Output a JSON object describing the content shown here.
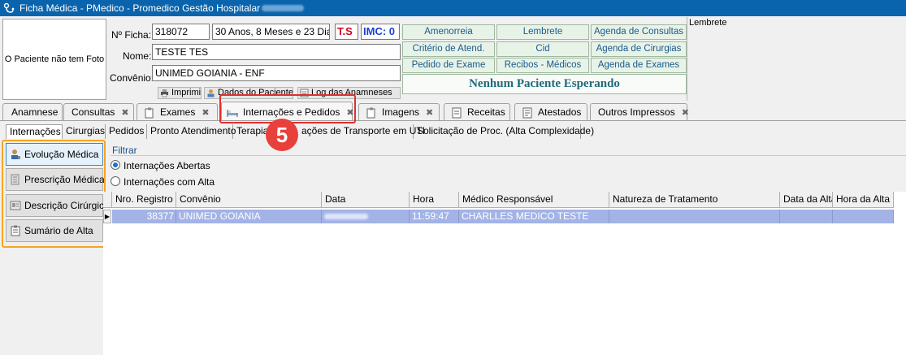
{
  "window": {
    "title": "Ficha Médica - PMedico - Promedico Gestão Hospitalar"
  },
  "patient": {
    "photo_text": "O Paciente não tem Foto",
    "ficha_label": "Nº Ficha:",
    "ficha_value": "318072",
    "age": "30 Anos, 8 Meses e 23 Dias",
    "ts": "T.S",
    "imc": "IMC: 0",
    "nome_label": "Nome:",
    "nome_value": "TESTE TES",
    "convenio_label": "Convênio:",
    "convenio_value": "UNIMED GOIANIA - ENF",
    "imprimir": "Imprimir",
    "dados": "Dados do Paciente",
    "log": "Log das Anamneses"
  },
  "shortcuts": {
    "r1": [
      "Amenorreia",
      "Lembrete",
      "Agenda de Consultas"
    ],
    "r2": [
      "Critério de Atend.",
      "Cid",
      "Agenda de Cirurgias"
    ],
    "r3": [
      "Pedido de Exame",
      "Recibos - Médicos",
      "Agenda de Exames"
    ],
    "waiting": "Nenhum Paciente Esperando"
  },
  "lembrete": {
    "label": "Lembrete"
  },
  "tabs": [
    "Anamnese",
    "Consultas",
    "Exames",
    "Internações e Pedidos",
    "Imagens",
    "Receitas",
    "Atestados",
    "Outros Impressos"
  ],
  "subtabs": [
    "Internações",
    "Cirurgias",
    "Pedidos",
    "Pronto Atendimento",
    "Terapias",
    "ações de Transporte em UTI",
    "Solicitação de Proc. (Alta Complexidade)"
  ],
  "leftbuttons": [
    "Evolução Médica",
    "Prescrição Médica",
    "Descrição Cirúrgica",
    "Sumário de Alta"
  ],
  "filter": {
    "label": "Filtrar",
    "opt1": "Internações Abertas",
    "opt2": "Internações com Alta",
    "selected": "Internações Abertas"
  },
  "grid": {
    "headers": [
      "Nro. Registro",
      "Convênio",
      "Data",
      "Hora",
      "Médico Responsável",
      "Natureza de Tratamento",
      "Data da Alta",
      "Hora da Alta"
    ],
    "row": {
      "registro": "38377",
      "convenio": "UNIMED GOIANIA",
      "hora": "11:59:47",
      "medico": "CHARLLES MEDICO TESTE"
    }
  },
  "annotation": {
    "step": "5"
  },
  "colors": {
    "titlebar": "#0a64ad",
    "selected_row": "#a3b3e6",
    "highlight_red": "#e03030",
    "highlight_orange": "#f5a623",
    "ts_red": "#d0021b",
    "imc_blue": "#1a3fd1"
  }
}
